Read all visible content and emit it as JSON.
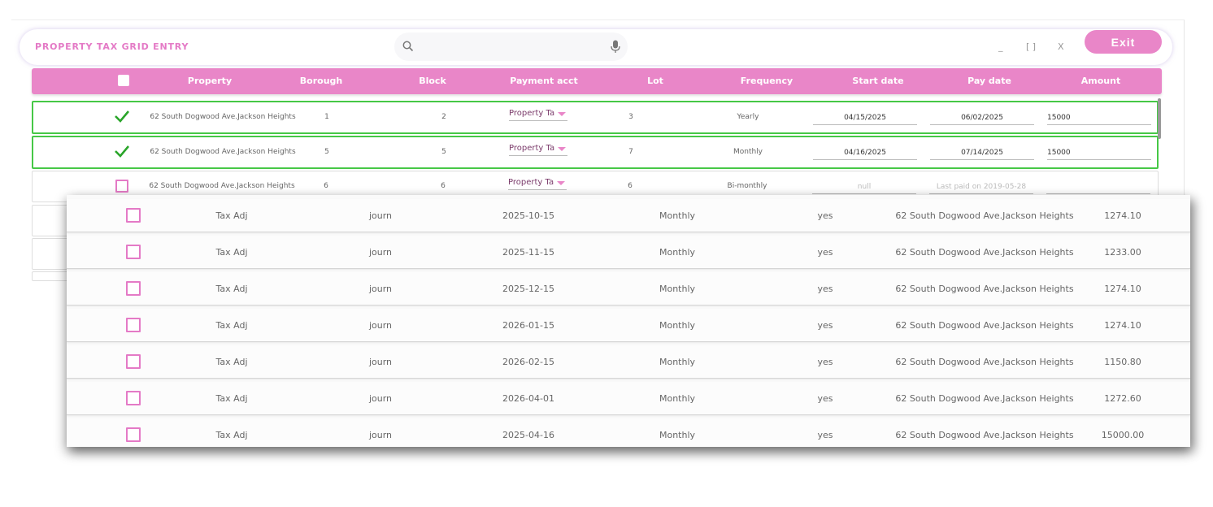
{
  "app": {
    "title": "PROPERTY TAX GRID ENTRY",
    "exit_label": "Exit",
    "window_controls": {
      "minimize": "_",
      "maximize": "[ ]",
      "close": "X"
    }
  },
  "search": {
    "placeholder": ""
  },
  "table": {
    "headers": [
      "Property",
      "Borough",
      "Block",
      "Payment acct",
      "Lot",
      "Frequency",
      "Start date",
      "Pay date",
      "Amount"
    ],
    "rows": [
      {
        "checked": true,
        "property": "62 South Dogwood Ave.Jackson Heights",
        "borough": "1",
        "block": "2",
        "payment_acct": "Property Ta",
        "lot": "3",
        "frequency": "Yearly",
        "start_date": "04/15/2025",
        "pay_date": "06/02/2025",
        "amount": "15000"
      },
      {
        "checked": true,
        "property": "62 South Dogwood Ave.Jackson Heights",
        "borough": "5",
        "block": "5",
        "payment_acct": "Property Ta",
        "lot": "7",
        "frequency": "Monthly",
        "start_date": "04/16/2025",
        "pay_date": "07/14/2025",
        "amount": "15000"
      },
      {
        "checked": false,
        "property": "62 South Dogwood Ave.Jackson Heights",
        "borough": "6",
        "block": "6",
        "payment_acct": "Property Ta",
        "lot": "6",
        "frequency": "Bi-monthly",
        "start_date": "null",
        "pay_date": "Last paid on 2019-05-28",
        "amount": ""
      }
    ]
  },
  "overlay": {
    "rows": [
      {
        "type": "Tax Adj",
        "source": "journ",
        "date": "2025-10-15",
        "frequency": "Monthly",
        "flag": "yes",
        "property": "62 South Dogwood Ave.Jackson Heights",
        "amount": "1274.10"
      },
      {
        "type": "Tax Adj",
        "source": "journ",
        "date": "2025-11-15",
        "frequency": "Monthly",
        "flag": "yes",
        "property": "62 South Dogwood Ave.Jackson Heights",
        "amount": "1233.00"
      },
      {
        "type": "Tax Adj",
        "source": "journ",
        "date": "2025-12-15",
        "frequency": "Monthly",
        "flag": "yes",
        "property": "62 South Dogwood Ave.Jackson Heights",
        "amount": "1274.10"
      },
      {
        "type": "Tax Adj",
        "source": "journ",
        "date": "2026-01-15",
        "frequency": "Monthly",
        "flag": "yes",
        "property": "62 South Dogwood Ave.Jackson Heights",
        "amount": "1274.10"
      },
      {
        "type": "Tax Adj",
        "source": "journ",
        "date": "2026-02-15",
        "frequency": "Monthly",
        "flag": "yes",
        "property": "62 South Dogwood Ave.Jackson Heights",
        "amount": "1150.80"
      },
      {
        "type": "Tax Adj",
        "source": "journ",
        "date": "2026-04-01",
        "frequency": "Monthly",
        "flag": "yes",
        "property": "62 South Dogwood Ave.Jackson Heights",
        "amount": "1272.60"
      },
      {
        "type": "Tax Adj",
        "source": "journ",
        "date": "2025-04-16",
        "frequency": "Monthly",
        "flag": "yes",
        "property": "62 South Dogwood Ave.Jackson Heights",
        "amount": "15000.00"
      }
    ]
  },
  "colors": {
    "accent": "#e986c8",
    "selected_border": "#46c846",
    "check": "#2aa52a"
  },
  "icons": {
    "search": "search-icon",
    "mic": "microphone-icon",
    "check": "checkmark-icon"
  }
}
